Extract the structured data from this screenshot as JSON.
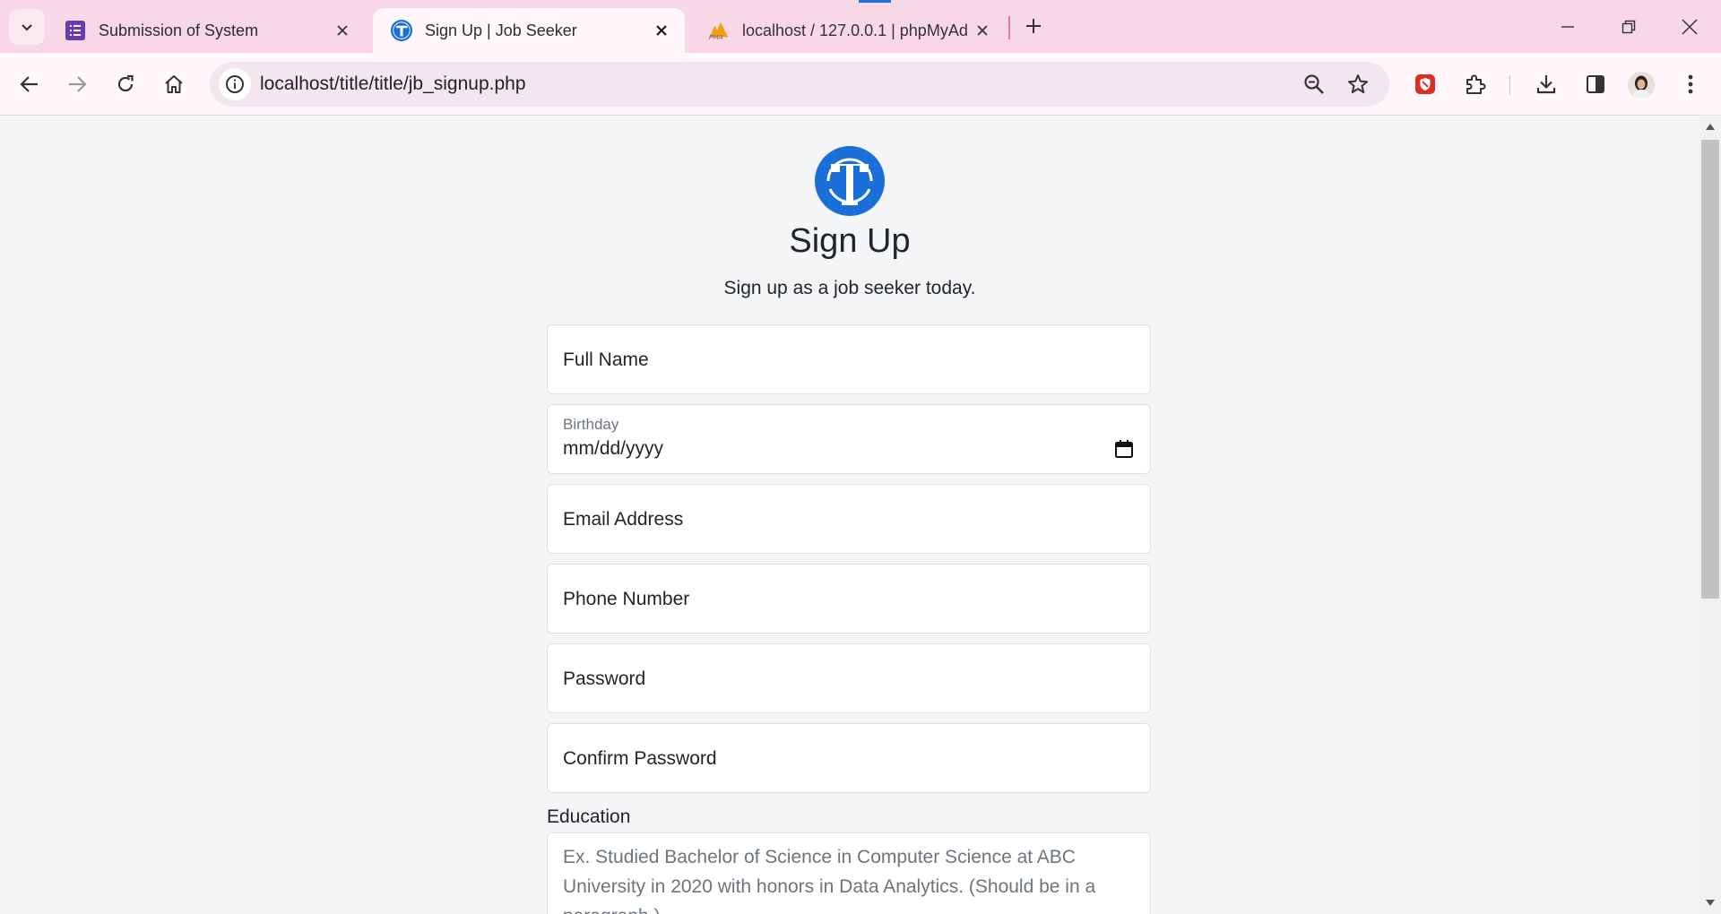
{
  "browser": {
    "tabs": [
      {
        "title": "Submission of System",
        "favicon": "forms-icon"
      },
      {
        "title": "Sign Up | Job Seeker",
        "favicon": "site-logo-icon"
      },
      {
        "title": "localhost / 127.0.0.1 | phpMyAd",
        "favicon": "phpmyadmin-icon"
      }
    ],
    "url": "localhost/title/title/jb_signup.php"
  },
  "page": {
    "title": "Sign Up",
    "subtitle": "Sign up as a job seeker today.",
    "fields": {
      "full_name": "Full Name",
      "birthday_label": "Birthday",
      "birthday_value": "mm/dd/yyyy",
      "email": "Email Address",
      "phone": "Phone Number",
      "password": "Password",
      "confirm_password": "Confirm Password"
    },
    "education": {
      "label": "Education",
      "placeholder": "Ex. Studied Bachelor of Science in Computer Science at ABC University in 2020 with honors in Data Analytics. (Should be in a paragraph.)"
    }
  },
  "colors": {
    "tabstrip": "#f8d7e7",
    "brand_blue": "#1a6fd8",
    "page_bg": "#f3f5f7"
  }
}
